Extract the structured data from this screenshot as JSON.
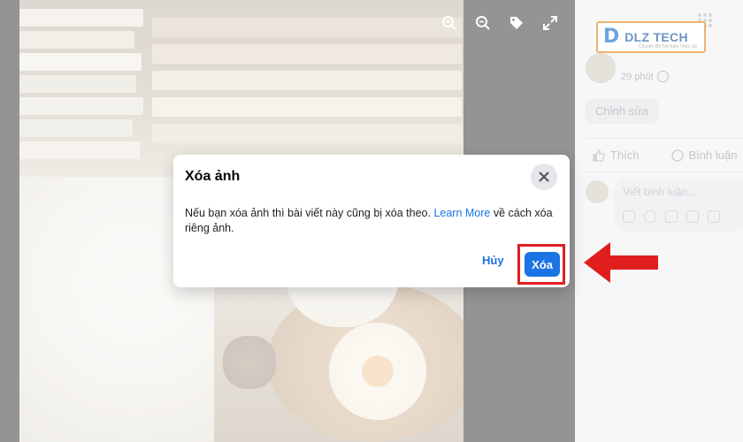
{
  "viewer": {
    "tools": [
      "zoom-in-icon",
      "zoom-out-icon",
      "tag-icon",
      "fullscreen-icon"
    ]
  },
  "sidebar": {
    "logo_text": "DLZ TECH",
    "logo_tagline": "Chuyên Bổ Trợ Kiến Thức Số",
    "post_time": "29 phút",
    "edit_label": "Chỉnh sửa",
    "like_label": "Thích",
    "comment_label": "Bình luận",
    "comment_placeholder": "Viết bình luận..."
  },
  "dialog": {
    "title": "Xóa ảnh",
    "body_before": "Nếu bạn xóa ảnh thì bài viết này cũng bị xóa theo. ",
    "link": "Learn More",
    "body_after": " về cách xóa riêng ảnh.",
    "cancel_label": "Hủy",
    "confirm_label": "Xóa"
  },
  "colors": {
    "accent": "#1b74e4",
    "highlight": "#e01e1e"
  }
}
